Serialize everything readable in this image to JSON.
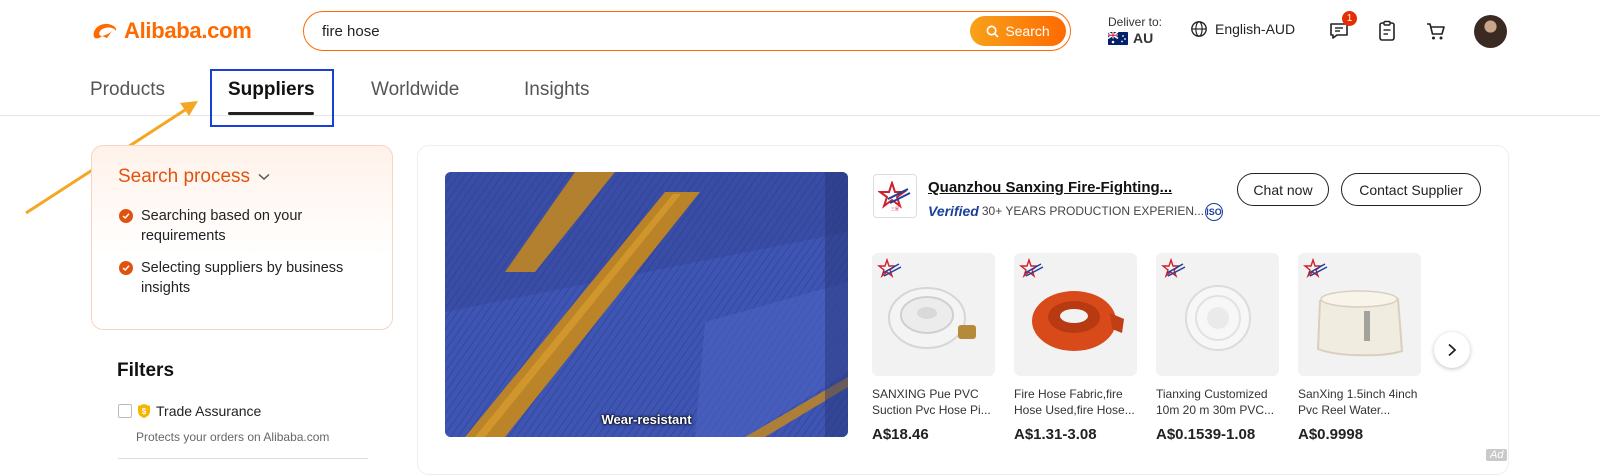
{
  "header": {
    "logo_text": "Alibaba.com",
    "search": {
      "value": "fire hose",
      "button_label": "Search"
    },
    "deliver_to": {
      "label": "Deliver to:",
      "country": "AU"
    },
    "language": "English-AUD",
    "messages_badge": "1"
  },
  "tabs": [
    {
      "label": "Products"
    },
    {
      "label": "Suppliers",
      "active": true
    },
    {
      "label": "Worldwide"
    },
    {
      "label": "Insights"
    }
  ],
  "search_process": {
    "title": "Search process",
    "steps": [
      "Searching based on your requirements",
      "Selecting suppliers by business insights"
    ]
  },
  "filters": {
    "title": "Filters",
    "trade_assurance": {
      "label": "Trade Assurance",
      "sub": "Protects your orders on Alibaba.com"
    }
  },
  "supplier": {
    "video_caption": "Wear-resistant",
    "name": "Quanzhou Sanxing Fire-Fighting...",
    "verified_word": "Verified",
    "verified_text": "30+ YEARS PRODUCTION EXPERIEN...",
    "iso": "ISO",
    "chat_label": "Chat now",
    "contact_label": "Contact Supplier",
    "ad_label": "Ad",
    "products": [
      {
        "name": "SANXING Pue PVC Suction Pvc Hose Pi...",
        "price": "A$18.46"
      },
      {
        "name": "Fire Hose Fabric,fire Hose Used,fire Hose...",
        "price": "A$1.31-3.08"
      },
      {
        "name": "Tianxing Customized 10m 20 m 30m PVC...",
        "price": "A$0.1539-1.08"
      },
      {
        "name": "SanXing 1.5inch 4inch Pvc Reel Water...",
        "price": "A$0.9998"
      }
    ]
  },
  "colors": {
    "brand": "#ff6a00",
    "highlight": "#1a3fd6",
    "arrow": "#f5a623"
  }
}
